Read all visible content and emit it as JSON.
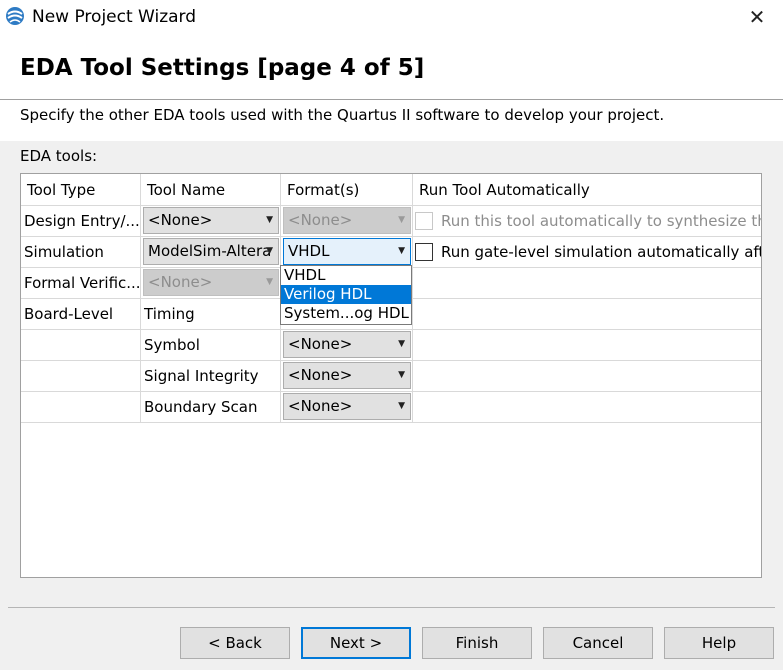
{
  "window": {
    "title": "New Project Wizard",
    "close_label": "✕",
    "icon": "quartus-app-icon"
  },
  "header": {
    "page_title": "EDA Tool Settings [page 4 of 5]",
    "description": "Specify the other EDA tools used with the Quartus II software to develop your project."
  },
  "table": {
    "section_label": "EDA tools:",
    "columns": [
      "Tool Type",
      "Tool Name",
      "Format(s)",
      "Run Tool Automatically"
    ],
    "rows": [
      {
        "type": "Design Entry/...",
        "name": "<None>",
        "format": "<None>",
        "run_label": "Run this tool automatically to synthesize the current design"
      },
      {
        "type": "Simulation",
        "name": "ModelSim-Altera",
        "format": "VHDL",
        "run_label": "Run gate-level simulation automatically after compilation"
      },
      {
        "type": "Formal Verific...",
        "name": "<None>",
        "format": "",
        "run_label": ""
      },
      {
        "type": "Board-Level",
        "name": "Timing",
        "format": "",
        "run_label": ""
      },
      {
        "type": "",
        "name": "Symbol",
        "format": "<None>",
        "run_label": ""
      },
      {
        "type": "",
        "name": "Signal Integrity",
        "format": "<None>",
        "run_label": ""
      },
      {
        "type": "",
        "name": "Boundary Scan",
        "format": "<None>",
        "run_label": ""
      }
    ]
  },
  "format_dropdown": {
    "options": [
      "VHDL",
      "Verilog HDL",
      "System...og HDL"
    ],
    "highlighted": "Verilog HDL"
  },
  "buttons": {
    "back": "< Back",
    "next": "Next >",
    "finish": "Finish",
    "cancel": "Cancel",
    "help": "Help"
  },
  "colors": {
    "accent": "#0078d7",
    "disabled_text": "#8d8d8d"
  }
}
